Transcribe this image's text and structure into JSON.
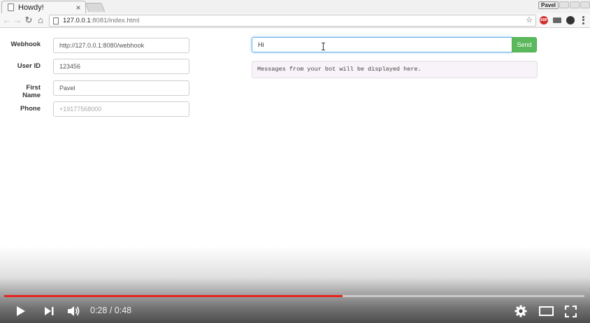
{
  "browser": {
    "tab_title": "Howdy!",
    "tab_close": "×",
    "profile_name": "Pavel",
    "url_host": "127.0.0.1",
    "url_rest": ":8081/index.html",
    "extensions": {
      "abp_label": "ABP"
    }
  },
  "form": {
    "webhook": {
      "label": "Webhook",
      "value": "http://127.0.0.1:8080/webhook"
    },
    "user_id": {
      "label": "User ID",
      "value": "123456"
    },
    "first_name": {
      "label": "First Name",
      "value": "Pavel"
    },
    "phone": {
      "label": "Phone",
      "value": "",
      "placeholder": "+19177568000"
    }
  },
  "chat": {
    "input_value": "Hi",
    "send_label": "Send",
    "messages_placeholder": "Messages from your bot will be displayed here."
  },
  "player": {
    "current_time": "0:28",
    "duration": "0:48",
    "time_separator": " / ",
    "progress_fraction": 0.5833,
    "colors": {
      "progress": "#e52420",
      "send_button": "#5cb85c"
    }
  }
}
